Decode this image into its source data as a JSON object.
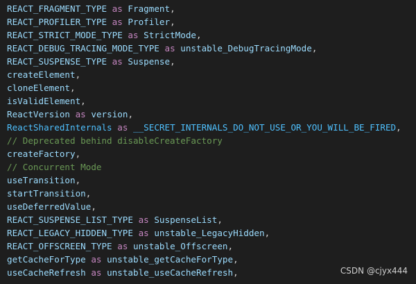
{
  "theme": {
    "background": "#1e1e1e",
    "const": "#4fc1ff",
    "identifier": "#9cdcfe",
    "keyword": "#c586c0",
    "punctuation": "#d4d4d4",
    "comment": "#6a9955"
  },
  "code": {
    "lines": [
      [
        {
          "t": "REACT_FRAGMENT_TYPE",
          "c": "var"
        },
        {
          "t": " "
        },
        {
          "t": "as",
          "c": "kw"
        },
        {
          "t": " "
        },
        {
          "t": "Fragment",
          "c": "var"
        },
        {
          "t": ",",
          "c": "punct"
        }
      ],
      [
        {
          "t": "REACT_PROFILER_TYPE",
          "c": "var"
        },
        {
          "t": " "
        },
        {
          "t": "as",
          "c": "kw"
        },
        {
          "t": " "
        },
        {
          "t": "Profiler",
          "c": "var"
        },
        {
          "t": ",",
          "c": "punct"
        }
      ],
      [
        {
          "t": "REACT_STRICT_MODE_TYPE",
          "c": "var"
        },
        {
          "t": " "
        },
        {
          "t": "as",
          "c": "kw"
        },
        {
          "t": " "
        },
        {
          "t": "StrictMode",
          "c": "var"
        },
        {
          "t": ",",
          "c": "punct"
        }
      ],
      [
        {
          "t": "REACT_DEBUG_TRACING_MODE_TYPE",
          "c": "var"
        },
        {
          "t": " "
        },
        {
          "t": "as",
          "c": "kw"
        },
        {
          "t": " "
        },
        {
          "t": "unstable_DebugTracingMode",
          "c": "var"
        },
        {
          "t": ",",
          "c": "punct"
        }
      ],
      [
        {
          "t": "REACT_SUSPENSE_TYPE",
          "c": "var"
        },
        {
          "t": " "
        },
        {
          "t": "as",
          "c": "kw"
        },
        {
          "t": " "
        },
        {
          "t": "Suspense",
          "c": "var"
        },
        {
          "t": ",",
          "c": "punct"
        }
      ],
      [
        {
          "t": "createElement",
          "c": "var"
        },
        {
          "t": ",",
          "c": "punct"
        }
      ],
      [
        {
          "t": "cloneElement",
          "c": "var"
        },
        {
          "t": ",",
          "c": "punct"
        }
      ],
      [
        {
          "t": "isValidElement",
          "c": "var"
        },
        {
          "t": ",",
          "c": "punct"
        }
      ],
      [
        {
          "t": "ReactVersion",
          "c": "var"
        },
        {
          "t": " "
        },
        {
          "t": "as",
          "c": "kw"
        },
        {
          "t": " "
        },
        {
          "t": "version",
          "c": "var"
        },
        {
          "t": ",",
          "c": "punct"
        }
      ],
      [
        {
          "t": "ReactSharedInternals",
          "c": "const"
        },
        {
          "t": " "
        },
        {
          "t": "as",
          "c": "kw"
        },
        {
          "t": " "
        },
        {
          "t": "__SECRET_INTERNALS_DO_NOT_USE_OR_YOU_WILL_BE_FIRED",
          "c": "const"
        },
        {
          "t": ",",
          "c": "punct"
        }
      ],
      [
        {
          "t": "// Deprecated behind disableCreateFactory",
          "c": "comment"
        }
      ],
      [
        {
          "t": "createFactory",
          "c": "var"
        },
        {
          "t": ",",
          "c": "punct"
        }
      ],
      [
        {
          "t": "// Concurrent Mode",
          "c": "comment"
        }
      ],
      [
        {
          "t": "useTransition",
          "c": "var"
        },
        {
          "t": ",",
          "c": "punct"
        }
      ],
      [
        {
          "t": "startTransition",
          "c": "var"
        },
        {
          "t": ",",
          "c": "punct"
        }
      ],
      [
        {
          "t": "useDeferredValue",
          "c": "var"
        },
        {
          "t": ",",
          "c": "punct"
        }
      ],
      [
        {
          "t": "REACT_SUSPENSE_LIST_TYPE",
          "c": "var"
        },
        {
          "t": " "
        },
        {
          "t": "as",
          "c": "kw"
        },
        {
          "t": " "
        },
        {
          "t": "SuspenseList",
          "c": "var"
        },
        {
          "t": ",",
          "c": "punct"
        }
      ],
      [
        {
          "t": "REACT_LEGACY_HIDDEN_TYPE",
          "c": "var"
        },
        {
          "t": " "
        },
        {
          "t": "as",
          "c": "kw"
        },
        {
          "t": " "
        },
        {
          "t": "unstable_LegacyHidden",
          "c": "var"
        },
        {
          "t": ",",
          "c": "punct"
        }
      ],
      [
        {
          "t": "REACT_OFFSCREEN_TYPE",
          "c": "var"
        },
        {
          "t": " "
        },
        {
          "t": "as",
          "c": "kw"
        },
        {
          "t": " "
        },
        {
          "t": "unstable_Offscreen",
          "c": "var"
        },
        {
          "t": ",",
          "c": "punct"
        }
      ],
      [
        {
          "t": "getCacheForType",
          "c": "var"
        },
        {
          "t": " "
        },
        {
          "t": "as",
          "c": "kw"
        },
        {
          "t": " "
        },
        {
          "t": "unstable_getCacheForType",
          "c": "var"
        },
        {
          "t": ",",
          "c": "punct"
        }
      ],
      [
        {
          "t": "useCacheRefresh",
          "c": "var"
        },
        {
          "t": " "
        },
        {
          "t": "as",
          "c": "kw"
        },
        {
          "t": " "
        },
        {
          "t": "unstable_useCacheRefresh",
          "c": "var"
        },
        {
          "t": ",",
          "c": "punct"
        }
      ]
    ]
  },
  "watermark": {
    "text": "CSDN @cjyx444"
  }
}
